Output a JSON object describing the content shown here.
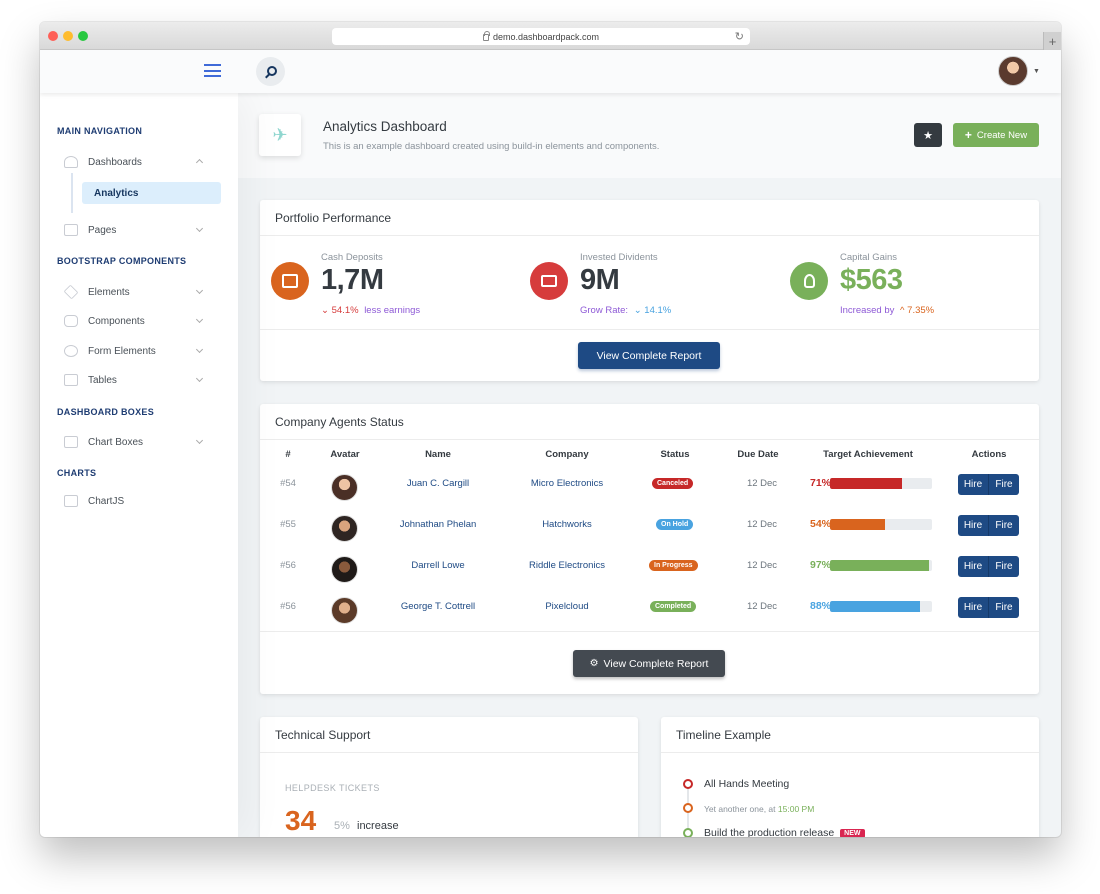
{
  "browser": {
    "url": "demo.dashboardpack.com",
    "reload_glyph": "↻",
    "newtab_glyph": "+"
  },
  "sidebar": {
    "headings": [
      "Main Navigation",
      "Bootstrap Components",
      "Dashboard Boxes",
      "Charts"
    ],
    "items": [
      {
        "label": "Dashboards",
        "icon": "rocket-icon"
      },
      {
        "label": "Analytics",
        "icon": ""
      },
      {
        "label": "Pages",
        "icon": "browser-icon"
      },
      {
        "label": "Elements",
        "icon": "diamond-icon"
      },
      {
        "label": "Components",
        "icon": "car-icon"
      },
      {
        "label": "Form Elements",
        "icon": "helm-icon"
      },
      {
        "label": "Tables",
        "icon": "display-icon"
      },
      {
        "label": "Chart Boxes",
        "icon": "graph-icon"
      },
      {
        "label": "ChartJS",
        "icon": "graph-icon"
      }
    ]
  },
  "header": {
    "title": "Analytics Dashboard",
    "subtitle": "This is an example dashboard created using build-in elements and components.",
    "star_glyph": "★",
    "create_label": "Create New",
    "create_plus": "+",
    "plane_glyph": "✈"
  },
  "portfolio": {
    "title": "Portfolio Performance",
    "metrics": [
      {
        "label": "Cash Deposits",
        "value": "1,7M",
        "arrow": "⌄",
        "sub_value": "54.1%",
        "sub_text": "less earnings",
        "color": "#d9641e"
      },
      {
        "label": "Invested Dividents",
        "value": "9M",
        "sub_text": "Grow Rate:",
        "arrow": "⌄",
        "sub_value": "14.1%",
        "color": "#d63c3c"
      },
      {
        "label": "Capital Gains",
        "value": "$563",
        "sub_text": "Increased by",
        "arrow": "^",
        "sub_value": "7.35%",
        "color": "#79b05a"
      }
    ],
    "button": "View Complete Report"
  },
  "agents": {
    "title": "Company Agents Status",
    "columns": [
      "#",
      "Avatar",
      "Name",
      "Company",
      "Status",
      "Due Date",
      "Target Achievement",
      "Actions"
    ],
    "rows": [
      {
        "id": "#54",
        "name": "Juan C. Cargill",
        "company": "Micro Electronics",
        "status": "Canceled",
        "status_color": "#c62828",
        "due": "12 Dec",
        "pct": "71%",
        "fill": 0.71,
        "color": "#c62828"
      },
      {
        "id": "#55",
        "name": "Johnathan Phelan",
        "company": "Hatchworks",
        "status": "On Hold",
        "status_color": "#49a3e0",
        "due": "12 Dec",
        "pct": "54%",
        "fill": 0.54,
        "color": "#d9641e"
      },
      {
        "id": "#56",
        "name": "Darrell Lowe",
        "company": "Riddle Electronics",
        "status": "In Progress",
        "status_color": "#d9641e",
        "due": "12 Dec",
        "pct": "97%",
        "fill": 0.97,
        "color": "#79b05a"
      },
      {
        "id": "#56",
        "name": "George T. Cottrell",
        "company": "Pixelcloud",
        "status": "Completed",
        "status_color": "#79b05a",
        "due": "12 Dec",
        "pct": "88%",
        "fill": 0.88,
        "color": "#49a3e0"
      }
    ],
    "hire_label": "Hire",
    "fire_label": "Fire",
    "button": "View Complete Report",
    "gear_glyph": "⚙"
  },
  "support": {
    "title": "Technical Support",
    "helpdesk_label": "HELPDESK TICKETS",
    "value": "34",
    "pct": "5%",
    "increase": "increase"
  },
  "timeline": {
    "title": "Timeline Example",
    "items": [
      {
        "text": "All Hands Meeting",
        "color": "#c62828"
      },
      {
        "text": "Yet another one, at",
        "time": "15:00 PM",
        "color": "#d9641e"
      },
      {
        "text": "Build the production release",
        "badge": "NEW",
        "color": "#79b05a"
      }
    ]
  }
}
